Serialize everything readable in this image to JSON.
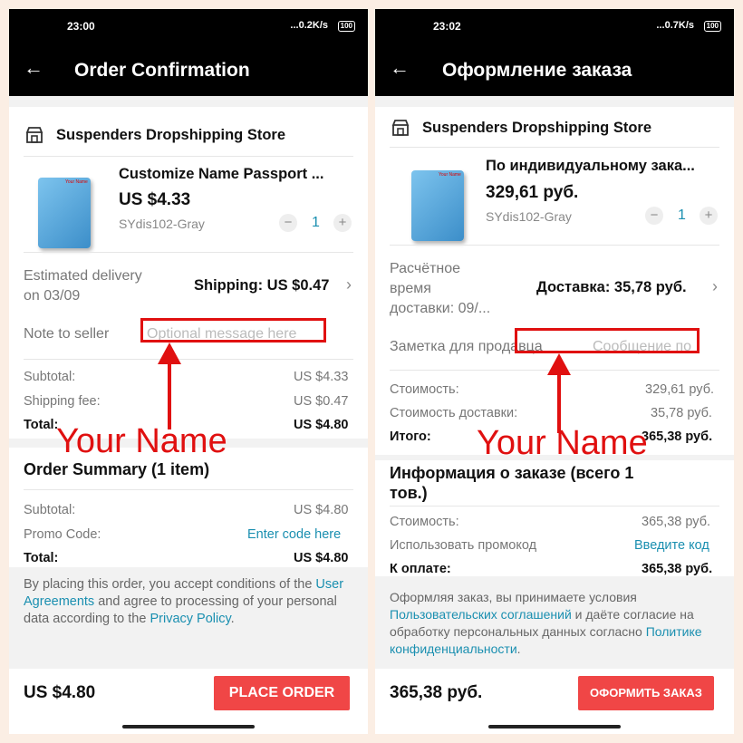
{
  "left": {
    "status": {
      "time": "23:00",
      "net": "...0.2K/s",
      "battery": "100"
    },
    "title": "Order Confirmation",
    "store": "Suspenders Dropshipping Store",
    "product": {
      "name": "Customize Name Passport ...",
      "price": "US $4.33",
      "variant": "SYdis102-Gray",
      "qty": "1",
      "image_label": "Your Name"
    },
    "delivery": {
      "label_1": "Estimated delivery",
      "label_2": "on 03/09",
      "shipping": "Shipping: US $0.47"
    },
    "note": {
      "label": "Note to seller",
      "placeholder": "Optional message here"
    },
    "totals": [
      {
        "label": "Subtotal:",
        "value": "US $4.33"
      },
      {
        "label": "Shipping fee:",
        "value": "US $0.47"
      },
      {
        "label": "Total:",
        "value": "US $4.80"
      }
    ],
    "annotation": "Your Name",
    "summary": {
      "title": "Order Summary (1 item)",
      "subtotal_label": "Subtotal:",
      "subtotal_value": "US $4.80",
      "promo_label": "Promo Code:",
      "promo_link": "Enter code here",
      "total_label": "Total:",
      "total_value": "US $4.80"
    },
    "policy": {
      "p1": "By placing this order, you accept conditions of the ",
      "link1": "User Agreements",
      "p2": " and agree to processing of your personal data according to the ",
      "link2": "Privacy Policy",
      "p3": "."
    },
    "bottom": {
      "total": "US $4.80",
      "button": "PLACE ORDER"
    }
  },
  "right": {
    "status": {
      "time": "23:02",
      "net": "...0.7K/s",
      "battery": "100"
    },
    "title": "Оформление заказа",
    "store": "Suspenders Dropshipping Store",
    "product": {
      "name": "По индивидуальному зака...",
      "price": "329,61 руб.",
      "variant": "SYdis102-Gray",
      "qty": "1",
      "image_label": "Your Name"
    },
    "delivery": {
      "label_1": "Расчётное",
      "label_2": "время",
      "label_3": "доставки: 09/...",
      "shipping": "Доставка: 35,78 руб."
    },
    "note": {
      "label": "Заметка для продавца",
      "placeholder": "Сообщение по"
    },
    "totals": [
      {
        "label": "Стоимость:",
        "value": "329,61 руб."
      },
      {
        "label": "Стоимость доставки:",
        "value": "35,78 руб."
      },
      {
        "label": "Итого:",
        "value": "365,38 руб."
      }
    ],
    "annotation": "Your Name",
    "summary": {
      "title_1": "Информация о заказе (всего 1",
      "title_2": "тов.)",
      "subtotal_label": "Стоимость:",
      "subtotal_value": "365,38 руб.",
      "promo_label": "Использовать промокод",
      "promo_link": "Введите код",
      "total_label": "К оплате:",
      "total_value": "365,38 руб."
    },
    "policy": {
      "p1": "Оформляя заказ, вы принимаете условия ",
      "link1": "Пользовательских соглашений",
      "p2": " и даёте согласие на обработку персональных данных согласно ",
      "link2": "Политике конфиденциальности",
      "p3": "."
    },
    "bottom": {
      "total": "365,38 руб.",
      "button": "ОФОРМИТЬ ЗАКАЗ"
    }
  },
  "colors": {
    "accent": "#f04646",
    "link": "#1a8fb0",
    "annotation": "#e01010",
    "frame": "#fbeee4"
  },
  "icons": {
    "back": "arrow-left-icon",
    "store": "store-icon",
    "chevron": "chevron-right-icon"
  }
}
